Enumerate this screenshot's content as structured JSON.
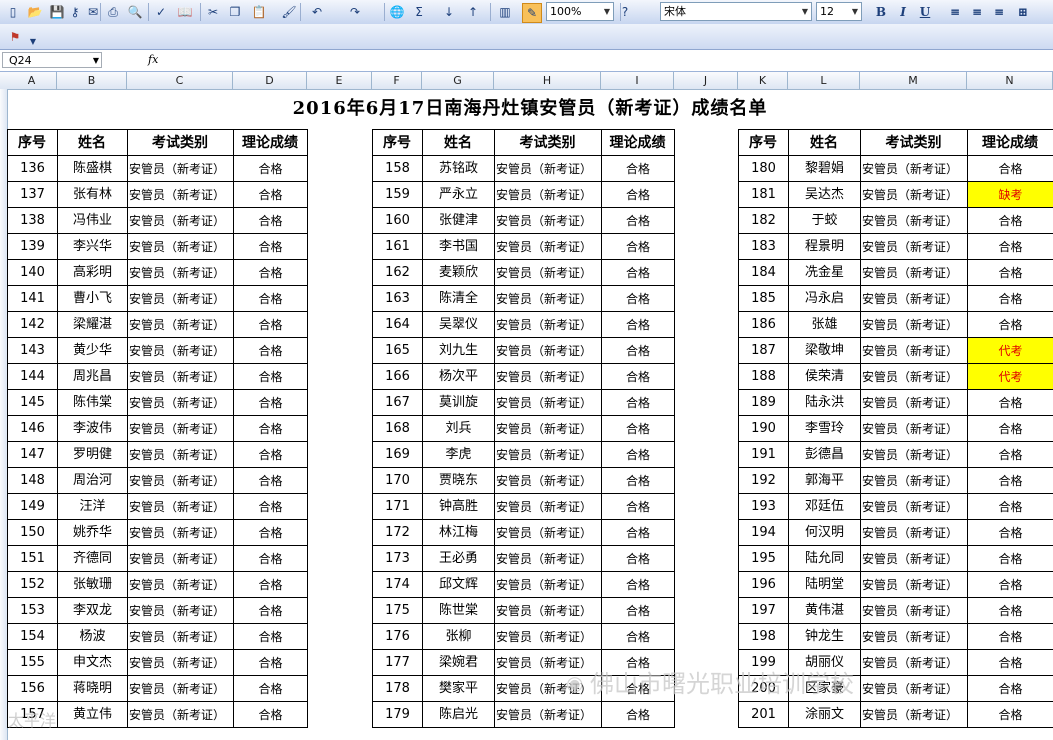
{
  "toolbar": {
    "zoom": "100%",
    "font_name": "宋体",
    "font_size": "12",
    "buttons": [
      {
        "name": "new-icon",
        "glyph": "▯"
      },
      {
        "name": "open-icon",
        "glyph": "📂"
      },
      {
        "name": "save-icon",
        "glyph": "💾"
      },
      {
        "name": "permission-icon",
        "glyph": "⚷"
      },
      {
        "name": "email-icon",
        "glyph": "✉"
      },
      {
        "name": "print-icon",
        "glyph": "⎙"
      },
      {
        "name": "print-preview-icon",
        "glyph": "🔍"
      },
      {
        "name": "spelling-icon",
        "glyph": "✓"
      },
      {
        "name": "research-icon",
        "glyph": "📖"
      },
      {
        "name": "cut-icon",
        "glyph": "✂"
      },
      {
        "name": "copy-icon",
        "glyph": "❐"
      },
      {
        "name": "paste-icon",
        "glyph": "📋"
      },
      {
        "name": "format-painter-icon",
        "glyph": "🖌"
      },
      {
        "name": "undo-icon",
        "glyph": "↶"
      },
      {
        "name": "redo-icon",
        "glyph": "↷"
      },
      {
        "name": "hyperlink-icon",
        "glyph": "🌐"
      },
      {
        "name": "autosum-icon",
        "glyph": "Σ"
      },
      {
        "name": "sort-ascending-icon",
        "glyph": "↓"
      },
      {
        "name": "sort-descending-icon",
        "glyph": "↑"
      },
      {
        "name": "chart-wizard-icon",
        "glyph": "▥"
      },
      {
        "name": "drawing-icon",
        "glyph": "✎"
      },
      {
        "name": "help-icon",
        "glyph": "?"
      }
    ],
    "format_buttons": [
      {
        "name": "bold-icon",
        "glyph": "B"
      },
      {
        "name": "italic-icon",
        "glyph": "I"
      },
      {
        "name": "underline-icon",
        "glyph": "U"
      },
      {
        "name": "align-left-icon",
        "glyph": "≡"
      },
      {
        "name": "align-center-icon",
        "glyph": "≡"
      },
      {
        "name": "align-right-icon",
        "glyph": "≡"
      },
      {
        "name": "merge-center-icon",
        "glyph": "⊞"
      }
    ],
    "second_row_icon": "pdf-convert-icon"
  },
  "formula_bar": {
    "name_box": "Q24",
    "fx_label": "fx",
    "formula": ""
  },
  "columns": [
    "A",
    "B",
    "C",
    "D",
    "E",
    "F",
    "G",
    "H",
    "I",
    "J",
    "K",
    "L",
    "M",
    "N"
  ],
  "sheet": {
    "title": "2016年6月17日南海丹灶镇安管员（新考证）成绩名单",
    "headers": [
      "序号",
      "姓名",
      "考试类别",
      "理论成绩"
    ],
    "exam_type": "安管员（新考证）",
    "groups": [
      [
        [
          "136",
          "陈盛棋",
          "合格"
        ],
        [
          "137",
          "张有林",
          "合格"
        ],
        [
          "138",
          "冯伟业",
          "合格"
        ],
        [
          "139",
          "李兴华",
          "合格"
        ],
        [
          "140",
          "高彩明",
          "合格"
        ],
        [
          "141",
          "曹小飞",
          "合格"
        ],
        [
          "142",
          "梁耀湛",
          "合格"
        ],
        [
          "143",
          "黄少华",
          "合格"
        ],
        [
          "144",
          "周兆昌",
          "合格"
        ],
        [
          "145",
          "陈伟棠",
          "合格"
        ],
        [
          "146",
          "李波伟",
          "合格"
        ],
        [
          "147",
          "罗明健",
          "合格"
        ],
        [
          "148",
          "周治河",
          "合格"
        ],
        [
          "149",
          "汪洋",
          "合格"
        ],
        [
          "150",
          "姚乔华",
          "合格"
        ],
        [
          "151",
          "齐德同",
          "合格"
        ],
        [
          "152",
          "张敏珊",
          "合格"
        ],
        [
          "153",
          "李双龙",
          "合格"
        ],
        [
          "154",
          "杨波",
          "合格"
        ],
        [
          "155",
          "申文杰",
          "合格"
        ],
        [
          "156",
          "蒋晓明",
          "合格"
        ],
        [
          "157",
          "黄立伟",
          "合格"
        ]
      ],
      [
        [
          "158",
          "苏铭政",
          "合格"
        ],
        [
          "159",
          "严永立",
          "合格"
        ],
        [
          "160",
          "张健津",
          "合格"
        ],
        [
          "161",
          "李书国",
          "合格"
        ],
        [
          "162",
          "麦颖欣",
          "合格"
        ],
        [
          "163",
          "陈清全",
          "合格"
        ],
        [
          "164",
          "吴翠仪",
          "合格"
        ],
        [
          "165",
          "刘九生",
          "合格"
        ],
        [
          "166",
          "杨次平",
          "合格"
        ],
        [
          "167",
          "莫训旋",
          "合格"
        ],
        [
          "168",
          "刘兵",
          "合格"
        ],
        [
          "169",
          "李虎",
          "合格"
        ],
        [
          "170",
          "贾晓东",
          "合格"
        ],
        [
          "171",
          "钟高胜",
          "合格"
        ],
        [
          "172",
          "林江梅",
          "合格"
        ],
        [
          "173",
          "王必勇",
          "合格"
        ],
        [
          "174",
          "邱文辉",
          "合格"
        ],
        [
          "175",
          "陈世棠",
          "合格"
        ],
        [
          "176",
          "张柳",
          "合格"
        ],
        [
          "177",
          "梁婉君",
          "合格"
        ],
        [
          "178",
          "樊家平",
          "合格"
        ],
        [
          "179",
          "陈启光",
          "合格"
        ]
      ],
      [
        [
          "180",
          "黎碧娟",
          "合格"
        ],
        [
          "181",
          "吴达杰",
          "缺考"
        ],
        [
          "182",
          "于蛟",
          "合格"
        ],
        [
          "183",
          "程景明",
          "合格"
        ],
        [
          "184",
          "冼金星",
          "合格"
        ],
        [
          "185",
          "冯永启",
          "合格"
        ],
        [
          "186",
          "张雄",
          "合格"
        ],
        [
          "187",
          "梁敬坤",
          "代考"
        ],
        [
          "188",
          "侯荣清",
          "代考"
        ],
        [
          "189",
          "陆永洪",
          "合格"
        ],
        [
          "190",
          "李雪玲",
          "合格"
        ],
        [
          "191",
          "彭德昌",
          "合格"
        ],
        [
          "192",
          "郭海平",
          "合格"
        ],
        [
          "193",
          "邓廷伍",
          "合格"
        ],
        [
          "194",
          "何汉明",
          "合格"
        ],
        [
          "195",
          "陆允同",
          "合格"
        ],
        [
          "196",
          "陆明堂",
          "合格"
        ],
        [
          "197",
          "黄伟湛",
          "合格"
        ],
        [
          "198",
          "钟龙生",
          "合格"
        ],
        [
          "199",
          "胡丽仪",
          "合格"
        ],
        [
          "200",
          "区家豪",
          "合格"
        ],
        [
          "201",
          "涂丽文",
          "合格"
        ]
      ]
    ]
  },
  "watermark": "佛山市曙光职业培训学校",
  "watermark2": "太平洋"
}
